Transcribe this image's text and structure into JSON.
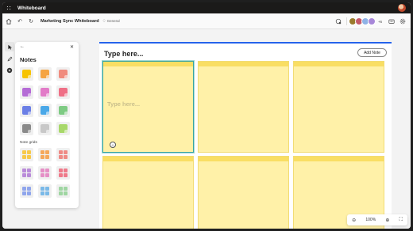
{
  "titlebar": {
    "app_name": "Whiteboard"
  },
  "cmdbar": {
    "board_title": "Marketing Sync Whiteboard",
    "sensitivity_label": "General",
    "collaborators_more": "+6",
    "collaborators": [
      {
        "color": "#9a7b2c",
        "initial": ""
      },
      {
        "color": "#c55a6b",
        "initial": ""
      },
      {
        "color": "#8fb2e6",
        "initial": ""
      },
      {
        "color": "#a787d8",
        "initial": ""
      }
    ]
  },
  "notes_panel": {
    "title": "Notes",
    "grids_label": "Note grids",
    "swatches": [
      {
        "color": "#f7c300",
        "icon": "yellow-note"
      },
      {
        "color": "#f5a442",
        "icon": "orange-note"
      },
      {
        "color": "#f08b7e",
        "icon": "coral-note"
      },
      {
        "color": "#b46bd6",
        "icon": "purple-note"
      },
      {
        "color": "#e27bc8",
        "icon": "pink-note"
      },
      {
        "color": "#ef6f86",
        "icon": "red-note"
      },
      {
        "color": "#6b7fe6",
        "icon": "indigo-note"
      },
      {
        "color": "#4aa8e8",
        "icon": "blue-note"
      },
      {
        "color": "#7ecb83",
        "icon": "green-note"
      },
      {
        "color": "#8a8a8a",
        "icon": "gray-note"
      },
      {
        "color": "#c8c8c8",
        "icon": "light-gray-note"
      },
      {
        "color": "#a8d86a",
        "icon": "lime-note"
      }
    ],
    "grids": [
      {
        "color": "#f7c94a"
      },
      {
        "color": "#f5a85c"
      },
      {
        "color": "#ef8a85"
      },
      {
        "color": "#b98bd9"
      },
      {
        "color": "#e58fc6"
      },
      {
        "color": "#ef7a8a"
      },
      {
        "color": "#8fa5ec"
      },
      {
        "color": "#7ab9e8"
      },
      {
        "color": "#9fd6a2"
      }
    ]
  },
  "board": {
    "label": "Type here...",
    "add_note_label": "Add Note",
    "selected_placeholder": "Type here..."
  },
  "zoom": {
    "level": "100%"
  }
}
